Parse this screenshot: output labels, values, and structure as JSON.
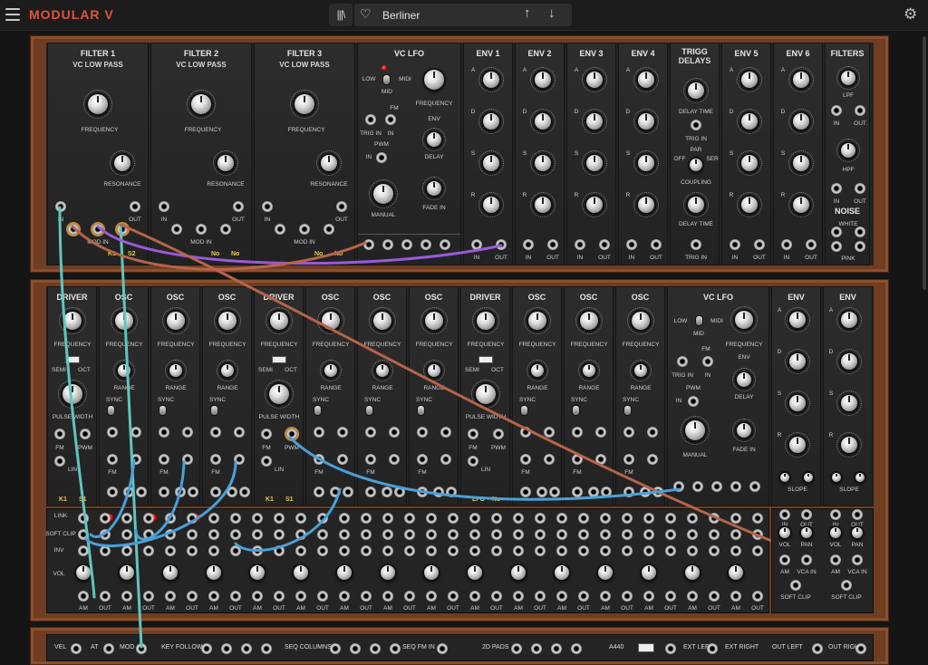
{
  "topbar": {
    "logo": "MODULAR V",
    "library_icon": "|||\\",
    "preset_name": "Berliner",
    "prev_icon": "arrow-up-icon",
    "next_icon": "arrow-down-icon"
  },
  "rack1": [
    {
      "title": "FILTER 1",
      "sub": "VC LOW PASS",
      "labels": [
        "FREQUENCY",
        "RESONANCE",
        "IN",
        "OUT",
        "MOD IN"
      ],
      "badges": [
        "K1",
        "S2"
      ]
    },
    {
      "title": "FILTER 2",
      "sub": "VC LOW PASS",
      "labels": [
        "FREQUENCY",
        "RESONANCE",
        "IN",
        "OUT",
        "MOD IN"
      ],
      "badges": [
        "No",
        "No"
      ]
    },
    {
      "title": "FILTER 3",
      "sub": "VC LOW PASS",
      "labels": [
        "FREQUENCY",
        "RESONANCE",
        "IN",
        "OUT",
        "MOD IN"
      ],
      "badges": [
        "No",
        "No"
      ]
    }
  ],
  "vclfo1": {
    "title": "VC LFO",
    "low": "LOW",
    "mid": "MID",
    "midi": "MIDI",
    "frequency": "FREQUENCY",
    "fm": "FM",
    "trig_in": "TRIG IN",
    "in": "IN",
    "pwm": "PWM",
    "manual": "MANUAL",
    "env": "ENV",
    "delay": "DELAY",
    "fade_in": "FADE IN"
  },
  "envs1": [
    {
      "title": "ENV 1"
    },
    {
      "title": "ENV 2"
    },
    {
      "title": "ENV 3"
    },
    {
      "title": "ENV 4"
    }
  ],
  "trigg": {
    "title": "TRIGG",
    "title2": "DELAYS",
    "delay_time": "DELAY TIME",
    "trig_in": "TRIG IN",
    "coupling": "COUPLING",
    "par": "PAR",
    "off": "OFF",
    "ser": "SER",
    "trig_in2": "TRIG IN"
  },
  "envs2": [
    {
      "title": "ENV 5"
    },
    {
      "title": "ENV 6"
    }
  ],
  "env_labels": {
    "a": "A",
    "d": "D",
    "s": "S",
    "r": "R",
    "in": "IN",
    "out": "OUT"
  },
  "filters_mod": {
    "title": "FILTERS",
    "lpf": "LPF",
    "hpf": "HPF",
    "in": "IN",
    "out": "OUT",
    "noise": "NOISE",
    "white": "WHITE",
    "pink": "PINK"
  },
  "rack2": [
    {
      "title": "DRIVER",
      "type": "driver",
      "badges": [
        "K1",
        "S1"
      ]
    },
    {
      "title": "OSC",
      "type": "osc"
    },
    {
      "title": "OSC",
      "type": "osc"
    },
    {
      "title": "OSC",
      "type": "osc"
    },
    {
      "title": "DRIVER",
      "type": "driver",
      "badges": [
        "K1",
        "S1"
      ]
    },
    {
      "title": "OSC",
      "type": "osc"
    },
    {
      "title": "OSC",
      "type": "osc"
    },
    {
      "title": "OSC",
      "type": "osc"
    },
    {
      "title": "DRIVER",
      "type": "driver",
      "badges": [
        "LFO",
        "No"
      ]
    },
    {
      "title": "OSC",
      "type": "osc"
    },
    {
      "title": "OSC",
      "type": "osc"
    },
    {
      "title": "OSC",
      "type": "osc"
    }
  ],
  "osc_labels": {
    "frequency": "FREQUENCY",
    "range": "RANGE",
    "sync": "SYNC",
    "fm": "FM",
    "semi": "SEMI",
    "oct": "OCT",
    "pulse_width": "PULSE WIDTH",
    "pwm": "PWM",
    "lin": "LIN"
  },
  "vclfo2": {
    "title": "VC LFO",
    "low": "LOW",
    "mid": "MID",
    "midi": "MIDI",
    "frequency": "FREQUENCY",
    "fm": "FM",
    "trig_in": "TRIG IN",
    "in": "IN",
    "pwm": "PWM",
    "manual": "MANUAL",
    "env": "ENV",
    "delay": "DELAY",
    "fade_in": "FADE IN"
  },
  "envs3": [
    {
      "title": "ENV"
    },
    {
      "title": "ENV"
    }
  ],
  "vca_labels": {
    "slope": "SLOPE",
    "in": "IN",
    "out": "OUT",
    "vol": "VOL",
    "pan": "PAN",
    "am": "AM",
    "vca_in": "VCA IN",
    "soft_clip": "SOFT CLIP"
  },
  "mixer": {
    "link": "LINK",
    "soft_clip": "SOFT CLIP",
    "inv": "INV",
    "vol": "VOL",
    "am": "AM",
    "out": "OUT",
    "lin": "LIN"
  },
  "bottom": {
    "vel": "VEL",
    "at": "AT",
    "mod": "MOD",
    "key_follow": "KEY FOLLOW",
    "seq_columns": "SEQ COLUMNS",
    "seq_fm_in": "SEQ FM IN",
    "pads": "2D PADS",
    "a440": "A440",
    "ext_left": "EXT LEFT",
    "ext_right": "EXT RIGHT",
    "out_left": "OUT LEFT",
    "out_right": "OUT RIGHT",
    "nums": [
      "1",
      "2",
      "3",
      "4"
    ],
    "xy": [
      "X",
      "Y",
      "X",
      "Y"
    ]
  },
  "colors": {
    "wood": "#6e3d22",
    "panel": "#262626",
    "cable_teal": "#5fc6c0",
    "cable_purple": "#9a5ad8",
    "cable_rust": "#b5644a",
    "cable_blue": "#4aa0d8",
    "led": "#d81818"
  }
}
